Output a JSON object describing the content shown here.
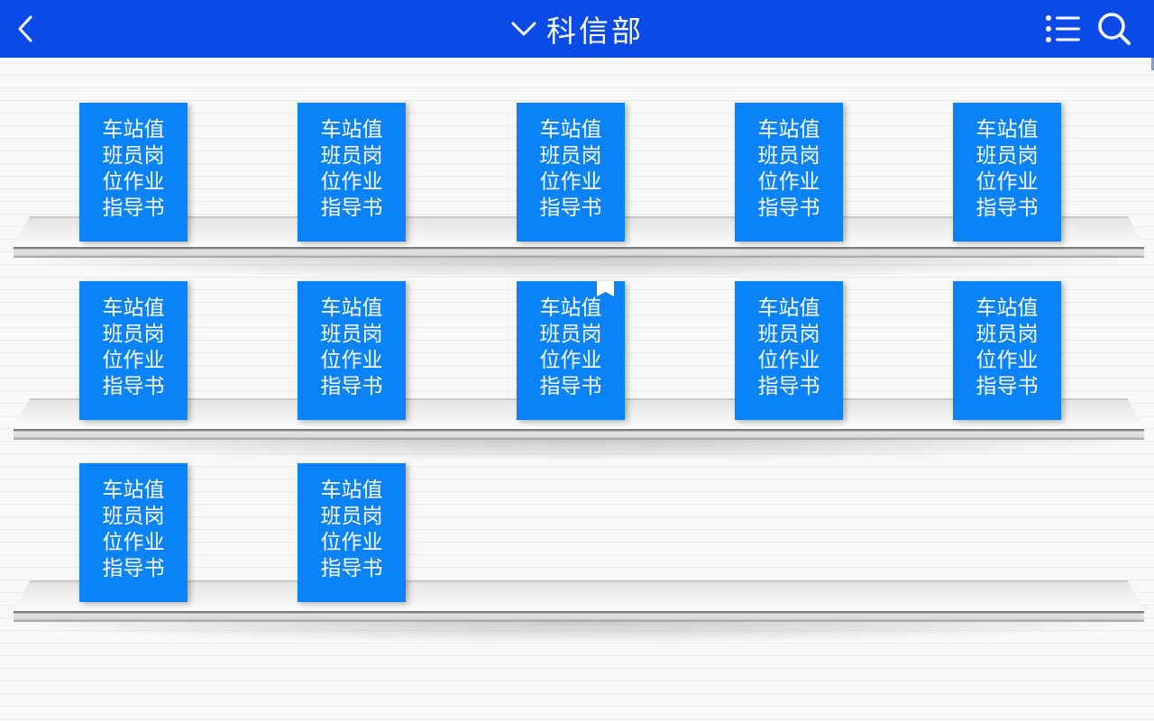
{
  "header": {
    "title": "科信部",
    "back_icon": "chevron-left-icon",
    "dropdown_icon": "chevron-down-icon",
    "menu_icon": "list-menu-icon",
    "search_icon": "search-icon",
    "background_color": "#0a4ae8"
  },
  "books": [
    {
      "title": "车站值班员岗位作业指导书",
      "bookmarked": false
    },
    {
      "title": "车站值班员岗位作业指导书",
      "bookmarked": false
    },
    {
      "title": "车站值班员岗位作业指导书",
      "bookmarked": false
    },
    {
      "title": "车站值班员岗位作业指导书",
      "bookmarked": false
    },
    {
      "title": "车站值班员岗位作业指导书",
      "bookmarked": false
    },
    {
      "title": "车站值班员岗位作业指导书",
      "bookmarked": false
    },
    {
      "title": "车站值班员岗位作业指导书",
      "bookmarked": false
    },
    {
      "title": "车站值班员岗位作业指导书",
      "bookmarked": true
    },
    {
      "title": "车站值班员岗位作业指导书",
      "bookmarked": false
    },
    {
      "title": "车站值班员岗位作业指导书",
      "bookmarked": false
    },
    {
      "title": "车站值班员岗位作业指导书",
      "bookmarked": false
    },
    {
      "title": "车站值班员岗位作业指导书",
      "bookmarked": false
    }
  ],
  "book_color": "#0a82f8"
}
